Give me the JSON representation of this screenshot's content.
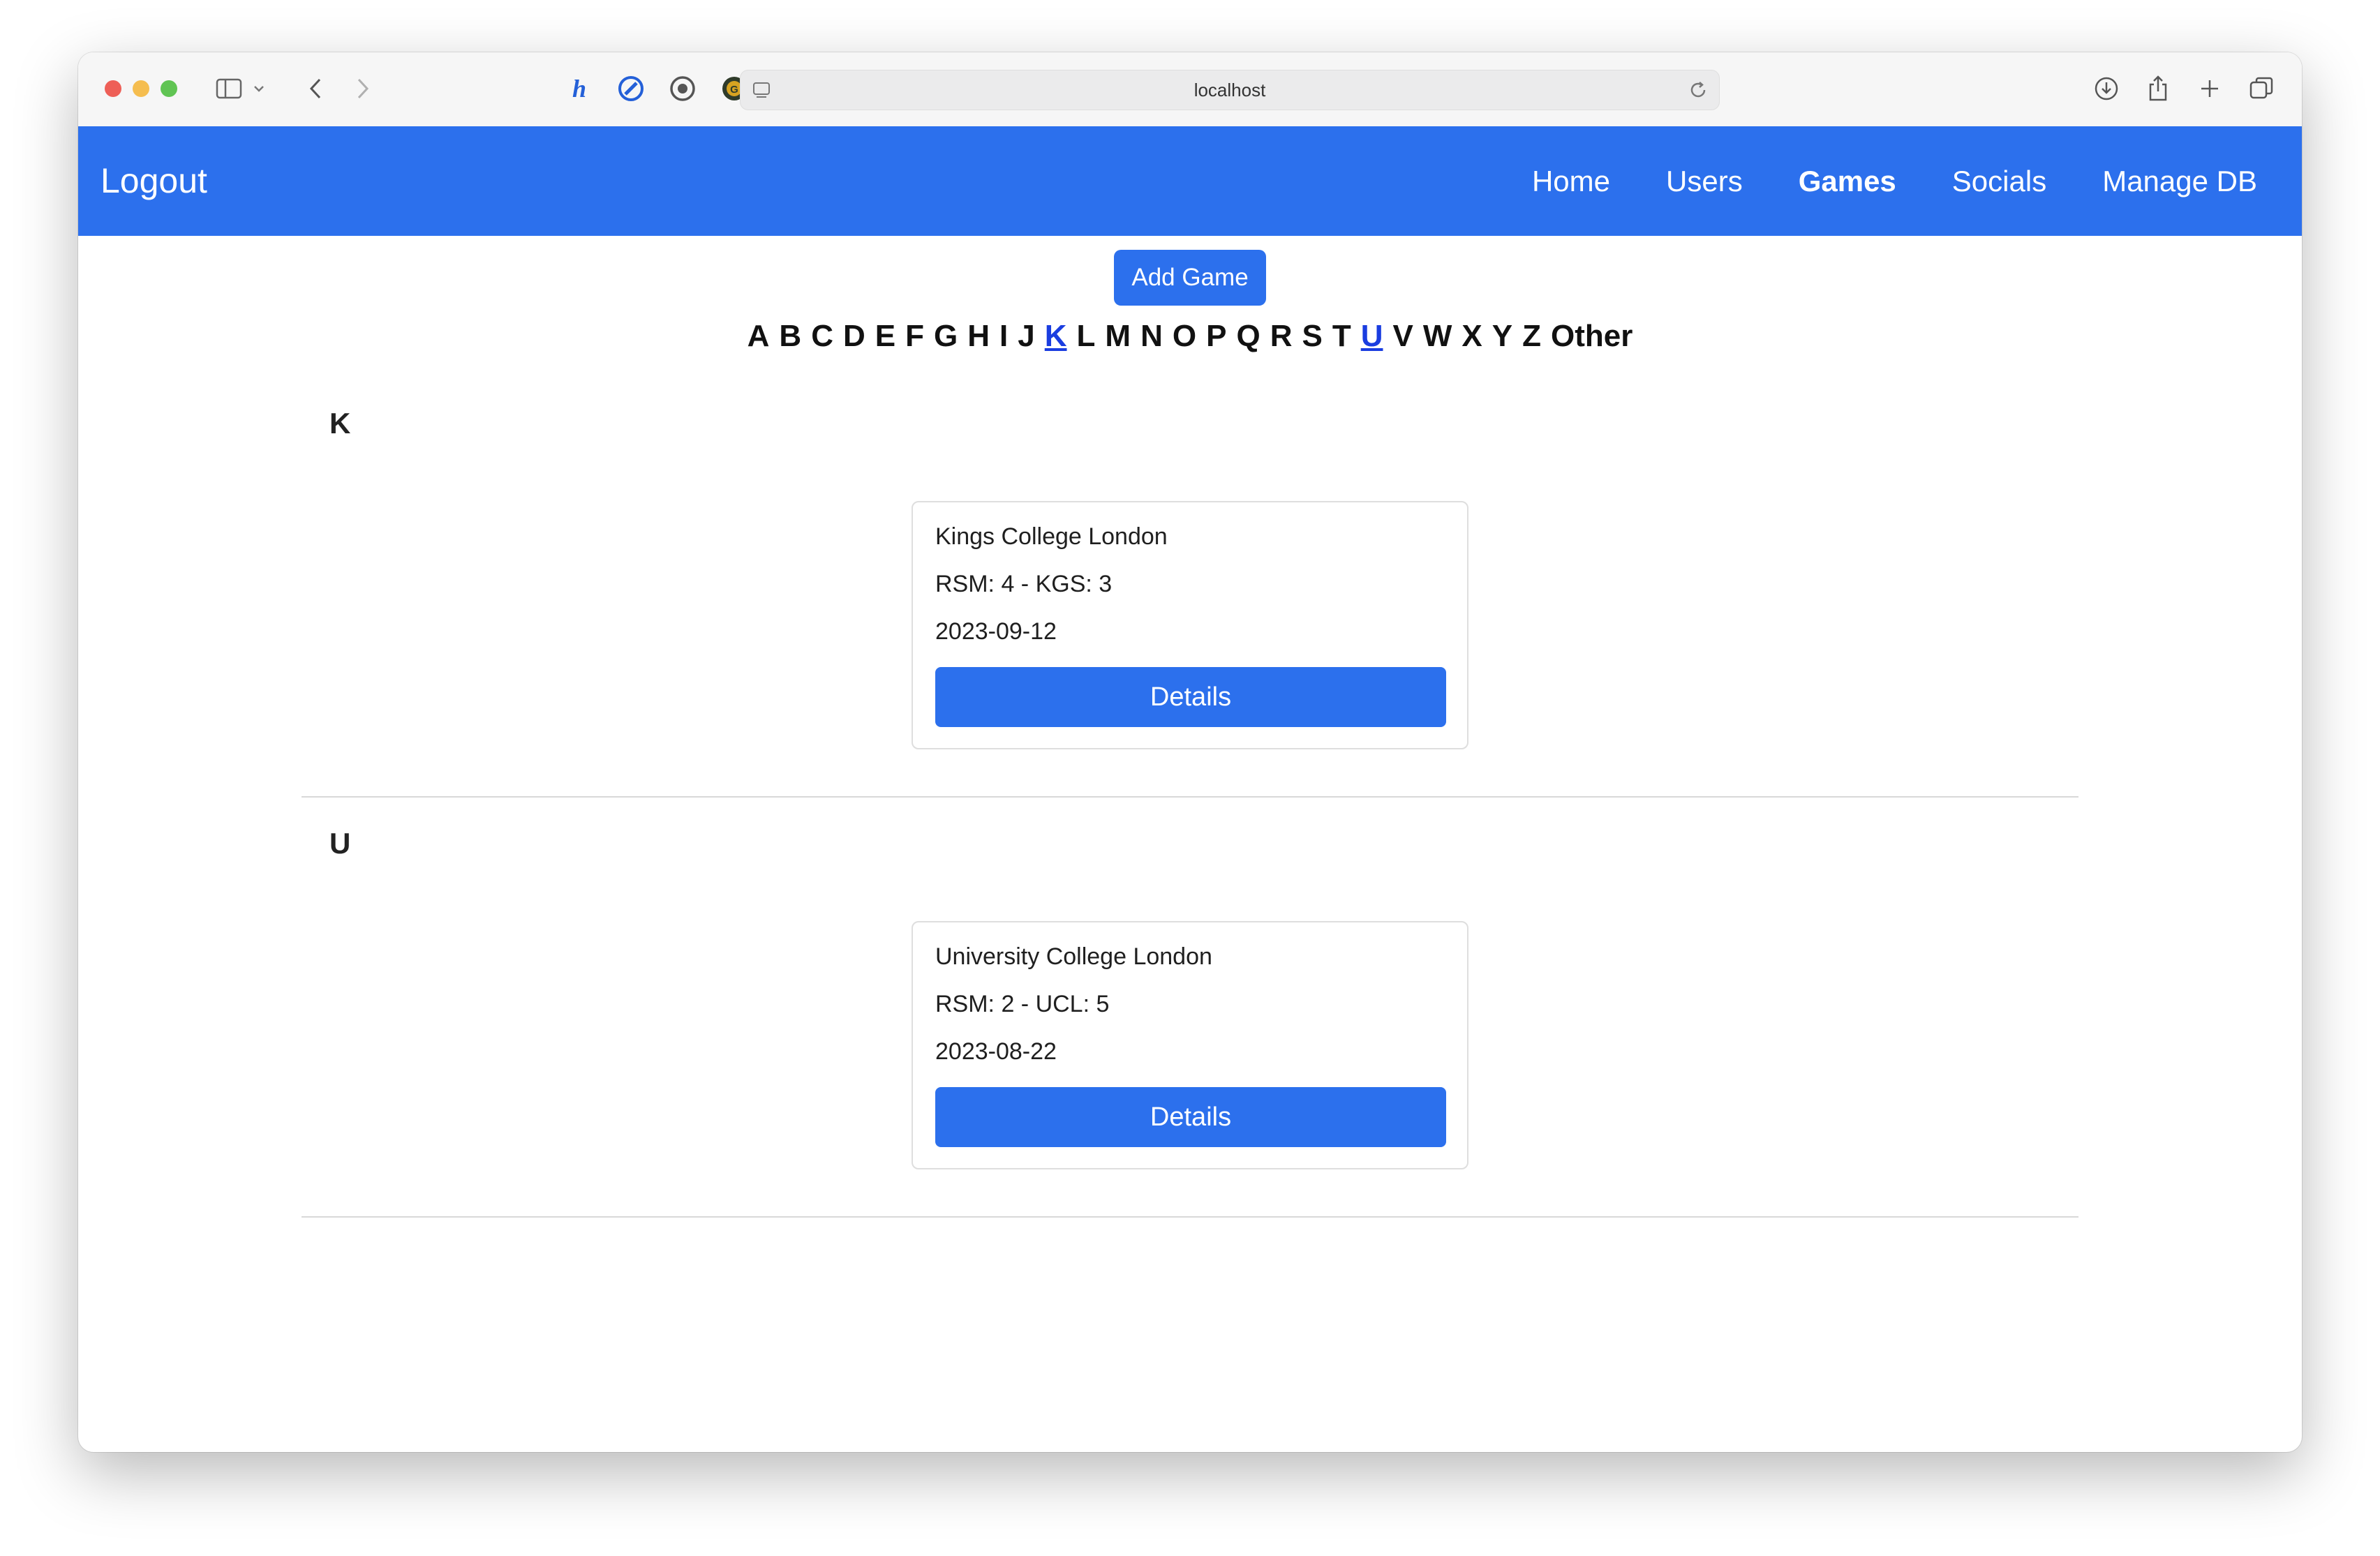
{
  "browser": {
    "url": "localhost",
    "extension_icons": [
      "honey-icon",
      "compass-icon",
      "circle-target-icon",
      "g-coin-icon",
      "grammarly-icon"
    ]
  },
  "colors": {
    "accent": "#2c70ed",
    "letter_link": "#1a3de0"
  },
  "navbar": {
    "brand": "Logout",
    "links": [
      {
        "label": "Home",
        "active": false
      },
      {
        "label": "Users",
        "active": false
      },
      {
        "label": "Games",
        "active": true
      },
      {
        "label": "Socials",
        "active": false
      },
      {
        "label": "Manage DB",
        "active": false
      }
    ]
  },
  "actions": {
    "add_game": "Add Game"
  },
  "letters": [
    "A",
    "B",
    "C",
    "D",
    "E",
    "F",
    "G",
    "H",
    "I",
    "J",
    "K",
    "L",
    "M",
    "N",
    "O",
    "P",
    "Q",
    "R",
    "S",
    "T",
    "U",
    "V",
    "W",
    "X",
    "Y",
    "Z",
    "Other"
  ],
  "letters_with_games": [
    "K",
    "U"
  ],
  "sections": [
    {
      "letter": "K",
      "games": [
        {
          "name": "Kings College London",
          "score": "RSM: 4 - KGS: 3",
          "date": "2023-09-12",
          "button": "Details"
        }
      ]
    },
    {
      "letter": "U",
      "games": [
        {
          "name": "University College London",
          "score": "RSM: 2 - UCL: 5",
          "date": "2023-08-22",
          "button": "Details"
        }
      ]
    }
  ]
}
